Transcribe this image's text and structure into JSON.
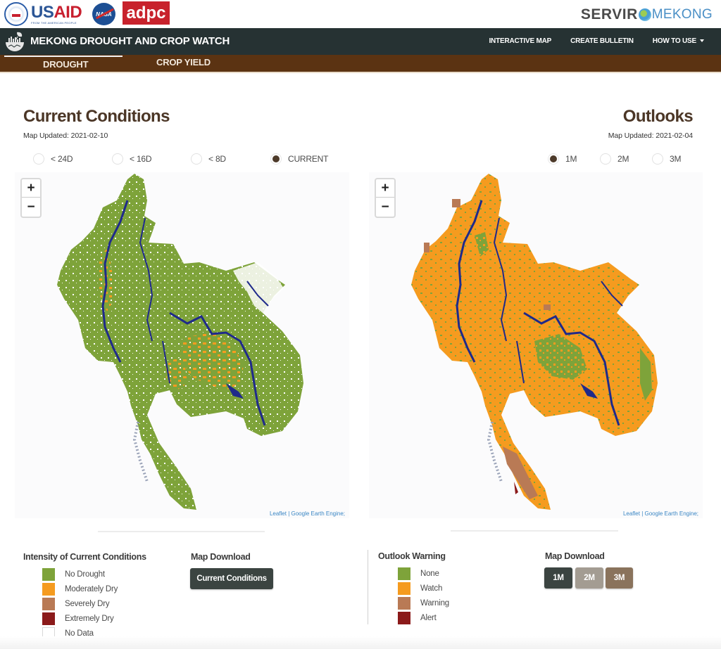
{
  "logos": {
    "usaid": {
      "us": "US",
      "aid": "AID",
      "tagline": "FROM THE AMERICAN PEOPLE"
    },
    "nasa": "NASA",
    "adpc": "adpc",
    "servir": {
      "servir": "SERVIR",
      "mekong": "MEKONG"
    }
  },
  "header": {
    "brand_title": "MEKONG DROUGHT AND CROP WATCH",
    "brand_icon": "crop-bowl-icon",
    "nav": [
      {
        "label": "INTERACTIVE MAP"
      },
      {
        "label": "CREATE BULLETIN"
      },
      {
        "label": "HOW TO USE",
        "has_dropdown": true
      }
    ]
  },
  "tabs": [
    {
      "label": "DROUGHT",
      "active": true
    },
    {
      "label": "CROP YIELD",
      "active": false
    }
  ],
  "current_conditions": {
    "title": "Current Conditions",
    "updated": "Map Updated: 2021-02-10",
    "periods": [
      {
        "label": "< 24D",
        "checked": false
      },
      {
        "label": "< 16D",
        "checked": false
      },
      {
        "label": "< 8D",
        "checked": false
      },
      {
        "label": "CURRENT",
        "checked": true
      }
    ],
    "map": {
      "zoom_in": "+",
      "zoom_out": "−",
      "attribution": "Leaflet | Google Earth Engine;",
      "dominant_class": "No Drought",
      "secondary_class": "Moderately Dry"
    },
    "legend": {
      "title": "Intensity of Current Conditions",
      "items": [
        {
          "label": "No Drought",
          "color": "#7ea33a"
        },
        {
          "label": "Moderately Dry",
          "color": "#f59b1f"
        },
        {
          "label": "Severely Dry",
          "color": "#b97a55"
        },
        {
          "label": "Extremely Dry",
          "color": "#8b1a1a"
        },
        {
          "label": "No Data",
          "color": "#ffffff"
        }
      ]
    },
    "download": {
      "title": "Map Download",
      "buttons": [
        {
          "label": "Current Conditions",
          "color": "#3b4441"
        }
      ]
    }
  },
  "outlooks": {
    "title": "Outlooks",
    "updated": "Map Updated: 2021-02-04",
    "periods": [
      {
        "label": "1M",
        "checked": true
      },
      {
        "label": "2M",
        "checked": false
      },
      {
        "label": "3M",
        "checked": false
      }
    ],
    "map": {
      "zoom_in": "+",
      "zoom_out": "−",
      "attribution": "Leaflet | Google Earth Engine;",
      "dominant_class": "Watch",
      "secondary_class": "None"
    },
    "legend": {
      "title": "Outlook Warning",
      "items": [
        {
          "label": "None",
          "color": "#7ea33a"
        },
        {
          "label": "Watch",
          "color": "#f59b1f"
        },
        {
          "label": "Warning",
          "color": "#b97a55"
        },
        {
          "label": "Alert",
          "color": "#8b1a1a"
        }
      ]
    },
    "download": {
      "title": "Map Download",
      "buttons": [
        {
          "label": "1M",
          "color": "#3b4441"
        },
        {
          "label": "2M",
          "color": "#a39c92"
        },
        {
          "label": "3M",
          "color": "#8a735c"
        }
      ]
    }
  },
  "colors": {
    "navbar": "#263233",
    "subnav": "#5b3312",
    "title": "#4b3626",
    "river": "#1f2a8a"
  }
}
